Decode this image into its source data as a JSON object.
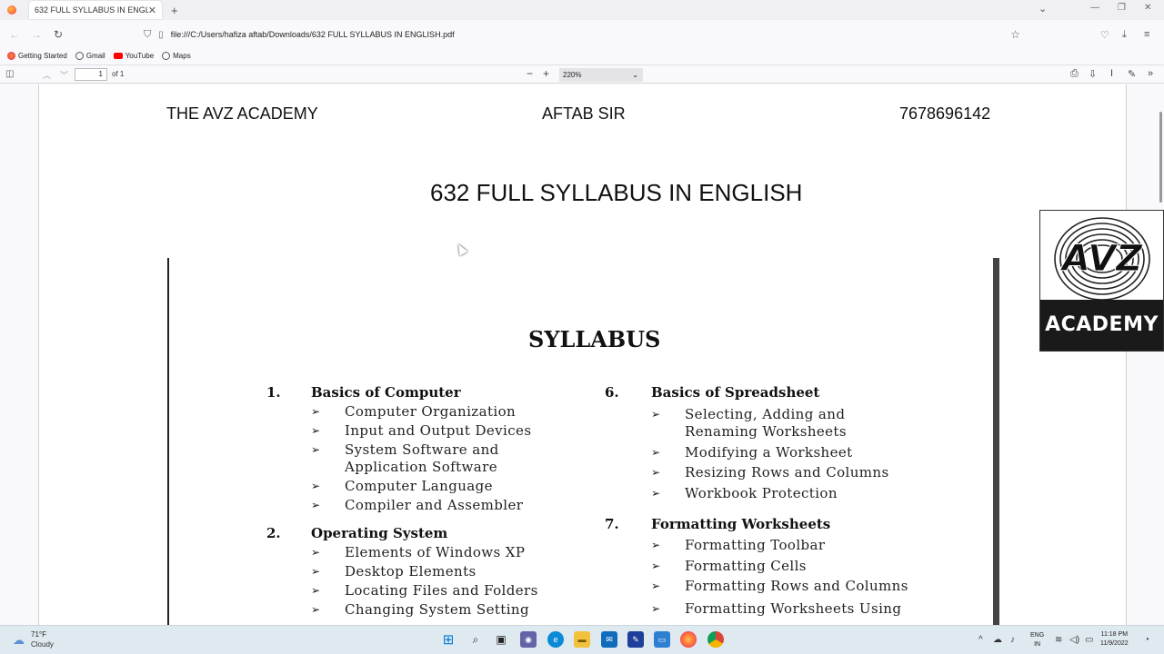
{
  "browser": {
    "tab_title": "632 FULL SYLLABUS IN ENGLISH.pdf",
    "url": "file:///C:/Users/hafiza aftab/Downloads/632 FULL SYLLABUS IN ENGLISH.pdf",
    "bookmarks": [
      "Getting Started",
      "Gmail",
      "YouTube",
      "Maps"
    ]
  },
  "pdf_toolbar": {
    "page_number": "1",
    "page_count": "of 1",
    "zoom": "220%"
  },
  "document": {
    "header_left": "THE AVZ ACADEMY",
    "header_center": "AFTAB SIR",
    "header_right": "7678696142",
    "title": "632 FULL SYLLABUS IN ENGLISH",
    "syllabus_heading": "SYLLABUS",
    "left_sections": [
      {
        "num": "1.",
        "title": "Basics of  Computer",
        "items": [
          "Computer Organization",
          "Input and Output Devices",
          "System Software and",
          "Application Software",
          "Computer Language",
          "Compiler and Assembler"
        ]
      },
      {
        "num": "2.",
        "title": "Operating System",
        "items": [
          "Elements of Windows XP",
          "Desktop Elements",
          "Locating Files and Folders",
          "Changing System Setting"
        ]
      }
    ],
    "right_sections": [
      {
        "num": "6.",
        "title": "Basics of Spreadsheet",
        "items": [
          "Selecting, Adding and",
          "Renaming Worksheets",
          "Modifying a Worksheet",
          "Resizing Rows and Columns",
          "Workbook Protection"
        ]
      },
      {
        "num": "7.",
        "title": "Formatting Worksheets",
        "items": [
          "Formatting Toolbar",
          "Formatting Cells",
          "Formatting Rows and Columns",
          "Formatting Worksheets Using"
        ]
      }
    ]
  },
  "logo": {
    "brand": "AVZ",
    "label": "ACADEMY"
  },
  "taskbar": {
    "temperature": "71°F",
    "condition": "Cloudy",
    "lang_top": "ENG",
    "lang_bottom": "IN",
    "time": "11:18 PM",
    "date": "11/9/2022"
  }
}
